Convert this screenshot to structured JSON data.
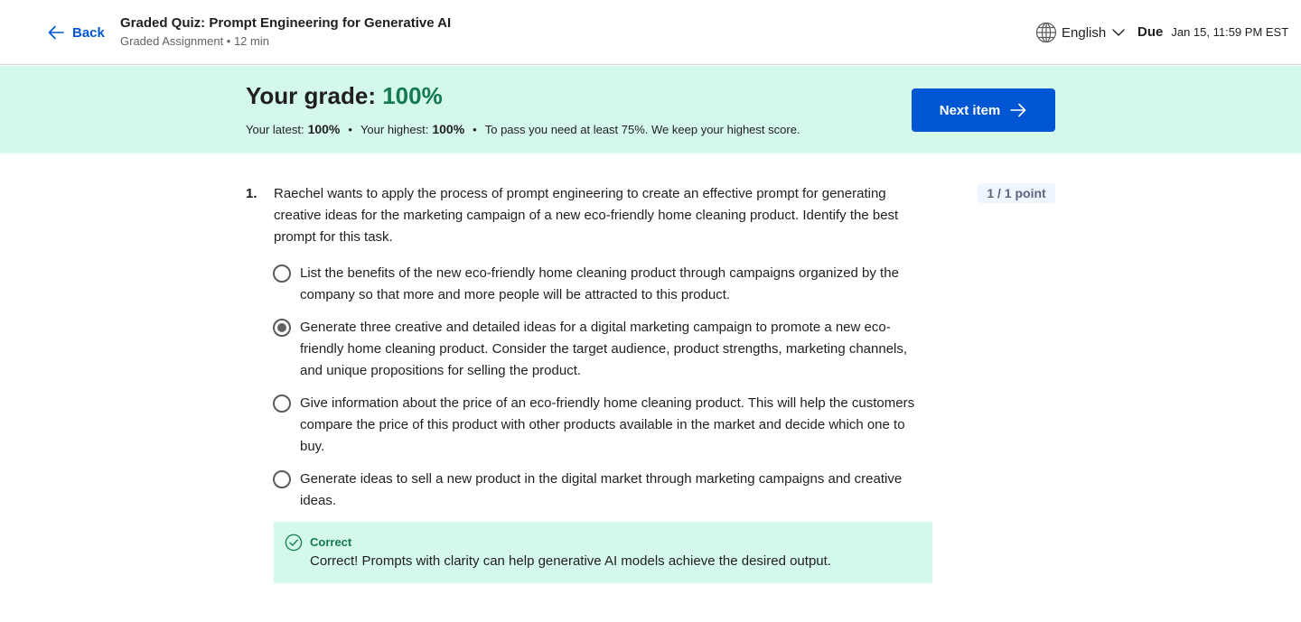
{
  "header": {
    "back_label": "Back",
    "title": "Graded Quiz: Prompt Engineering for Generative AI",
    "subtitle": "Graded Assignment • 12 min",
    "language": "English",
    "due_label": "Due",
    "due_date": "Jan 15, 11:59 PM EST"
  },
  "grade": {
    "label": "Your grade: ",
    "value": "100%",
    "latest_label": "Your latest:",
    "latest_value": "100%",
    "highest_label": "Your highest:",
    "highest_value": "100%",
    "separator": "•",
    "pass_note": "To pass you need at least 75%. We keep your highest score.",
    "next_label": "Next item"
  },
  "question": {
    "number": "1.",
    "text": "Raechel wants to apply the process of prompt engineering to create an effective prompt for generating creative ideas for the marketing campaign of a new eco-friendly home cleaning product. Identify the best prompt for this task.",
    "points": "1 / 1 point",
    "options": [
      {
        "text": "List the benefits of the new eco-friendly home cleaning product through campaigns organized by the company so that more and more people will be attracted to this product.",
        "selected": false
      },
      {
        "text": "Generate three creative and detailed ideas for a digital marketing campaign to promote a new eco-friendly home cleaning product. Consider the target audience, product strengths, marketing channels, and unique propositions for selling the product.",
        "selected": true
      },
      {
        "text": "Give information about the price of an eco-friendly home cleaning product. This will help the customers compare the price of this product with other products available in the market and decide which one to buy.",
        "selected": false
      },
      {
        "text": "Generate ideas to sell a new product in the digital market through marketing campaigns and creative ideas.",
        "selected": false
      }
    ],
    "feedback": {
      "label": "Correct",
      "text": "Correct! Prompts with clarity can help generative AI models achieve the desired output."
    }
  },
  "colors": {
    "accent": "#0056d2",
    "success": "#137a52",
    "banner_bg": "#d4f8ea"
  }
}
